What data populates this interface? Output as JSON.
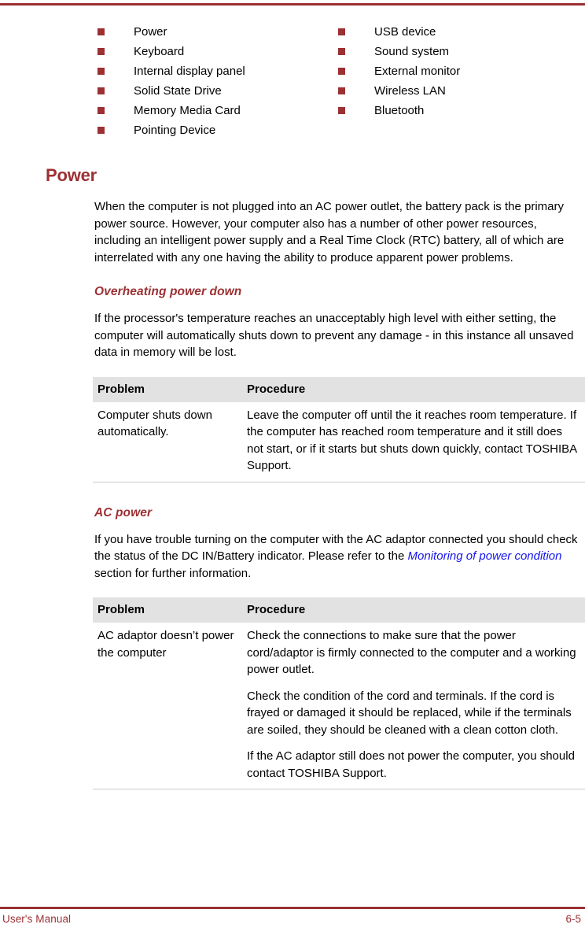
{
  "document": {
    "footer_left": "User's Manual",
    "footer_page": "6-5",
    "accent_color": "#9c3033",
    "link_color": "#1414ef",
    "table_header_bg": "#e2e2e2"
  },
  "checklist": {
    "column_1": [
      {
        "label": "Power"
      },
      {
        "label": "Keyboard"
      },
      {
        "label": "Internal display panel"
      },
      {
        "label": "Solid State Drive"
      },
      {
        "label": "Memory Media Card"
      },
      {
        "label": "Pointing Device"
      }
    ],
    "column_2": [
      {
        "label": "USB device"
      },
      {
        "label": "Sound system"
      },
      {
        "label": "External monitor"
      },
      {
        "label": "Wireless LAN"
      },
      {
        "label": "Bluetooth"
      }
    ]
  },
  "power_section": {
    "title": "Power",
    "intro": "When the computer is not plugged into an AC power outlet, the battery pack is the primary power source. However, your computer also has a number of other power resources, including an intelligent power supply and a Real Time Clock (RTC) battery, all of which are interrelated with any one having the ability to produce apparent power problems."
  },
  "overheating": {
    "title": "Overheating power down",
    "intro": "If the processor's temperature reaches an unacceptably high level with either setting, the computer will automatically shuts down to prevent any damage - in this instance all unsaved data in memory will be lost.",
    "table": {
      "headers": {
        "problem": "Problem",
        "procedure": "Procedure"
      },
      "rows": [
        {
          "problem": "Computer shuts down automatically.",
          "procedure": [
            "Leave the computer off until the it reaches room temperature. If the computer has reached room temperature and it still does not start, or if it starts but shuts down quickly, contact TOSHIBA Support."
          ]
        }
      ]
    }
  },
  "ac_power": {
    "title": "AC power",
    "intro_before_link": "If you have trouble turning on the computer with the AC adaptor connected you should check the status of the DC IN/Battery indicator. Please refer to the ",
    "link_text": "Monitoring of power condition",
    "intro_after_link": " section for further information.",
    "table": {
      "headers": {
        "problem": "Problem",
        "procedure": "Procedure"
      },
      "rows": [
        {
          "problem": "AC adaptor doesn’t power the computer",
          "procedure": [
            "Check the connections to make sure that the power cord/adaptor is firmly connected to the computer and a working power outlet.",
            "Check the condition of the cord and terminals. If the cord is frayed or damaged it should be replaced, while if the terminals are soiled, they should be cleaned with a clean cotton cloth.",
            "If the AC adaptor still does not power the computer, you should contact TOSHIBA Support."
          ]
        }
      ]
    }
  }
}
